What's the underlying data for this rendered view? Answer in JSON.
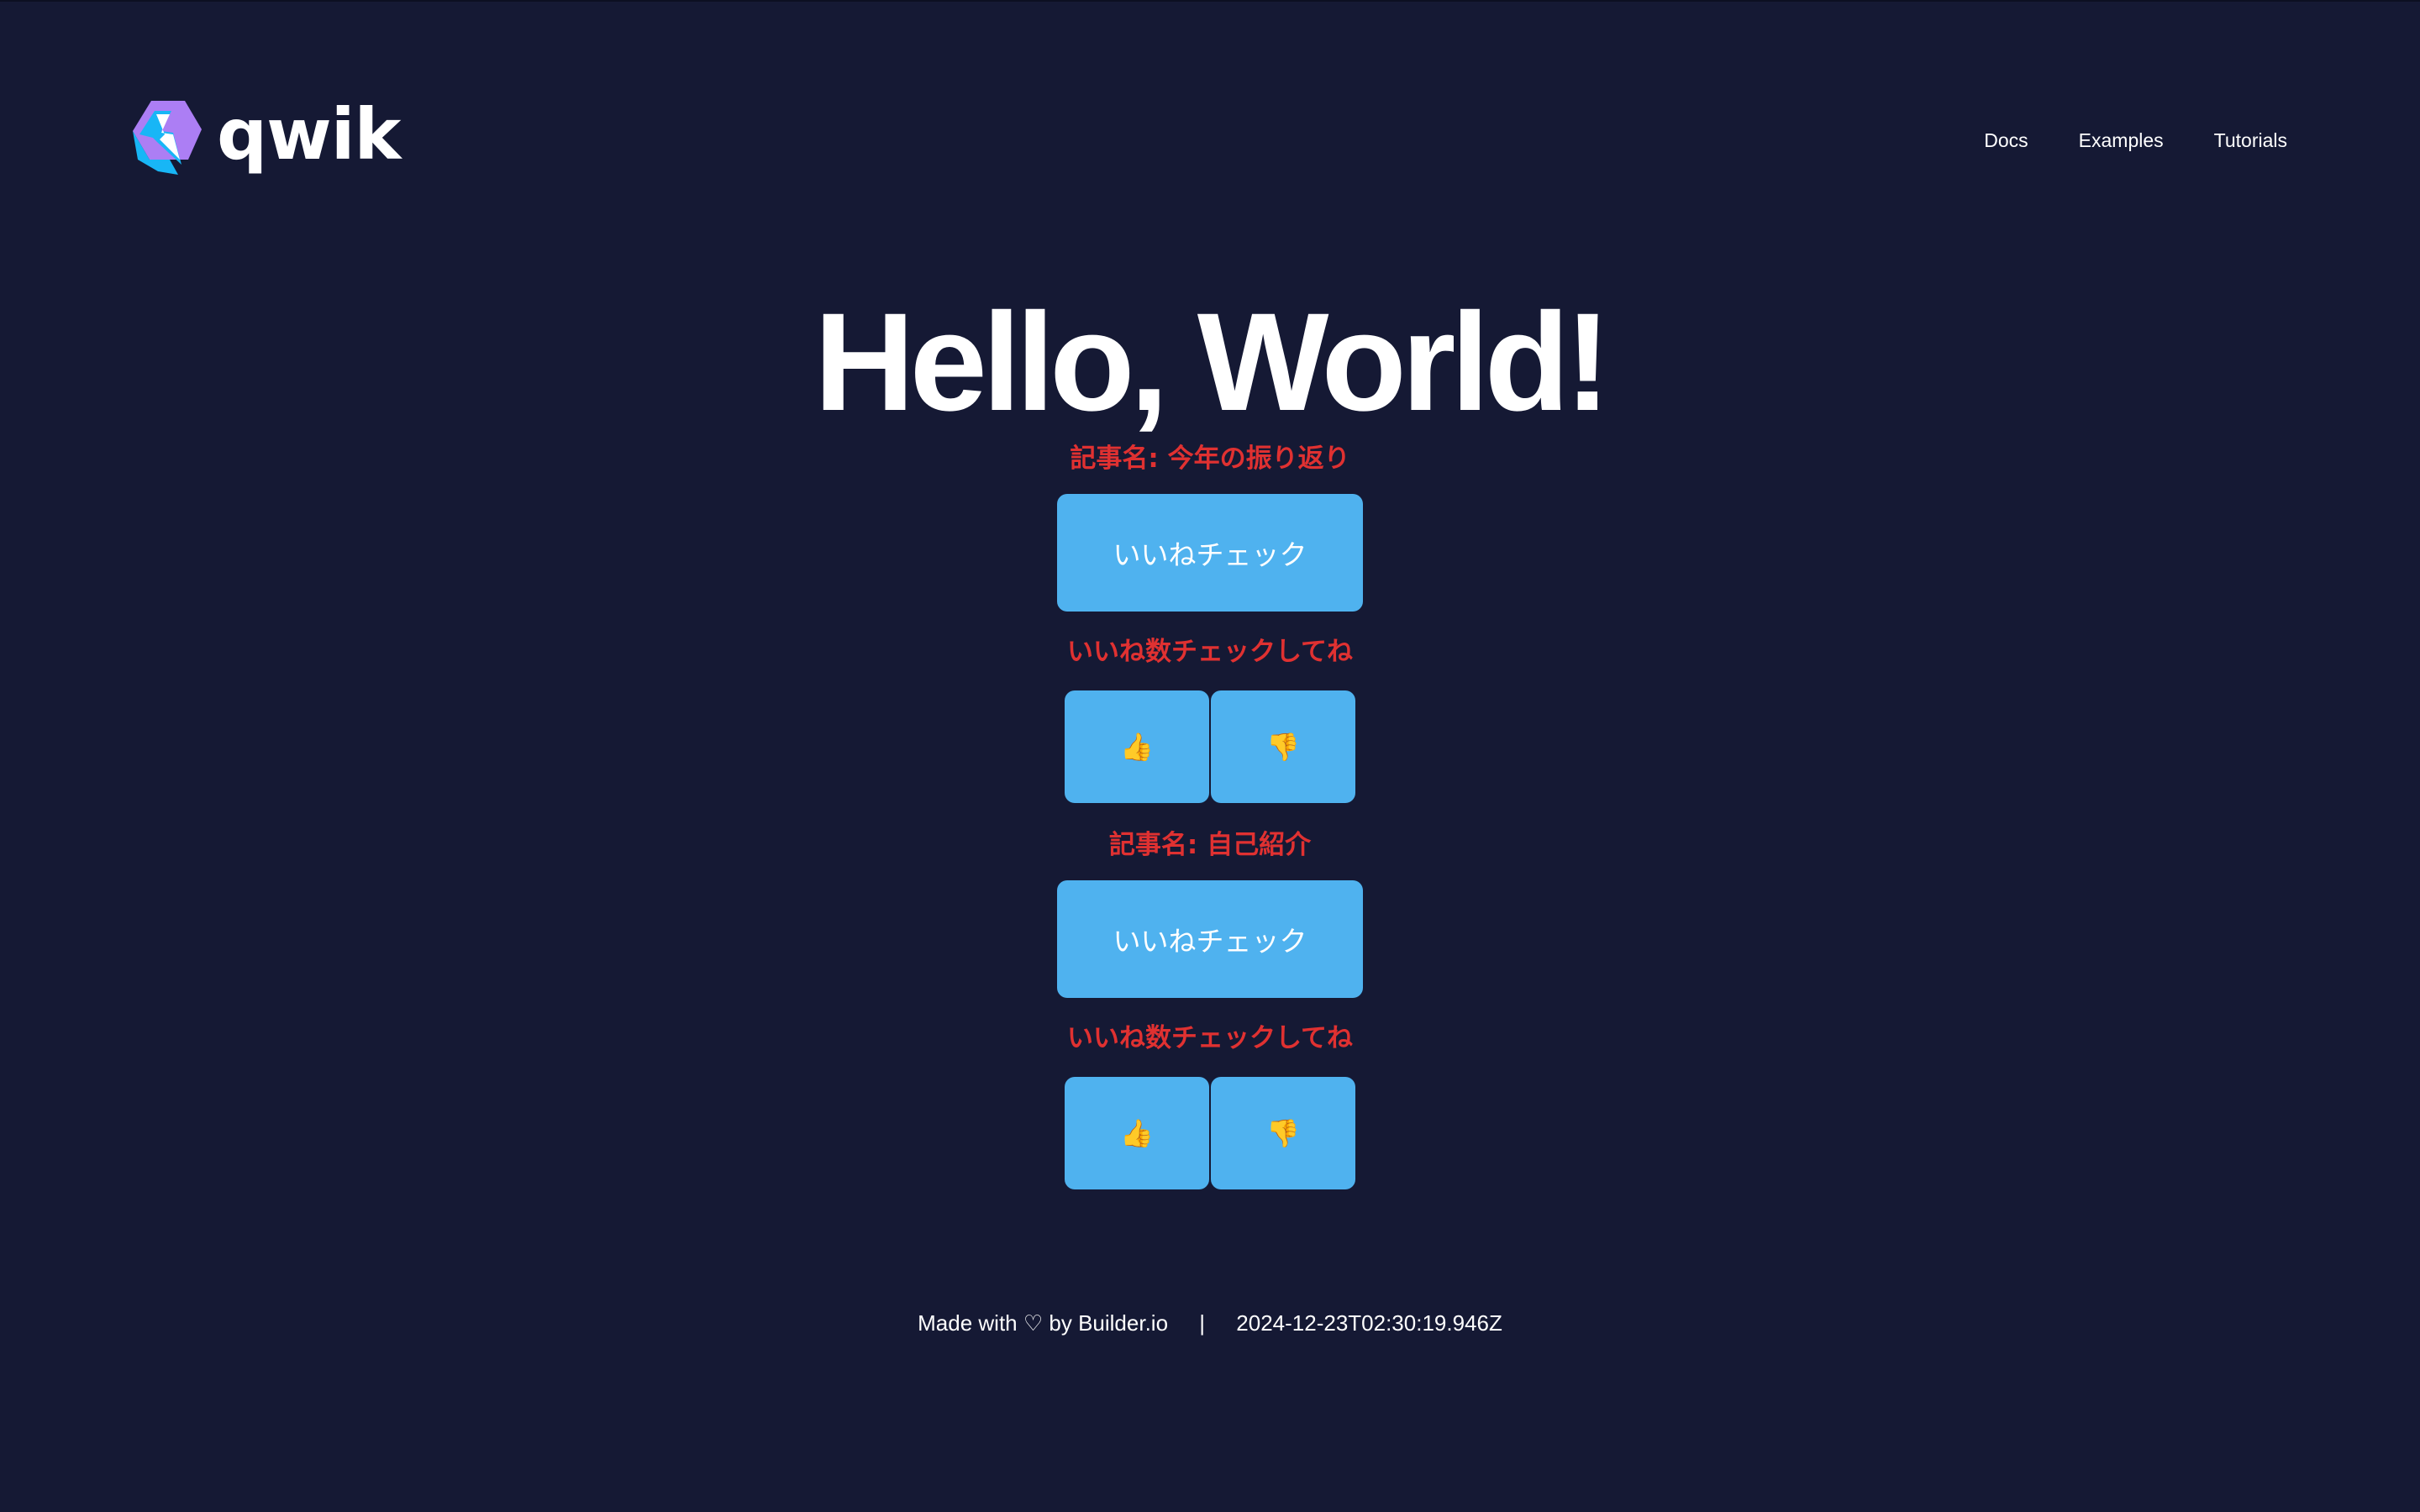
{
  "header": {
    "logo_text": "qwik",
    "nav": [
      "Docs",
      "Examples",
      "Tutorials"
    ]
  },
  "main": {
    "heading": "Hello, World!",
    "articles": [
      {
        "title": "記事名: 今年の振り返り",
        "like_check_label": "いいねチェック",
        "hint": "いいね数チェックしてね",
        "thumbs_up": "👍",
        "thumbs_down": "👎"
      },
      {
        "title": "記事名: 自己紹介",
        "like_check_label": "いいねチェック",
        "hint": "いいね数チェックしてね",
        "thumbs_up": "👍",
        "thumbs_down": "👎"
      }
    ]
  },
  "footer": {
    "made_with": "Made with ♡ by Builder.io",
    "separator": "|",
    "timestamp": "2024-12-23T02:30:19.946Z"
  },
  "colors": {
    "background": "#151934",
    "accent_button": "#4fb2ef",
    "title_red": "#e03131",
    "logo_purple": "#ac7ef4",
    "logo_blue": "#18b6f6"
  },
  "icons": {
    "logo": "qwik-logo-icon",
    "thumbs_up": "thumbs-up-icon",
    "thumbs_down": "thumbs-down-icon"
  }
}
